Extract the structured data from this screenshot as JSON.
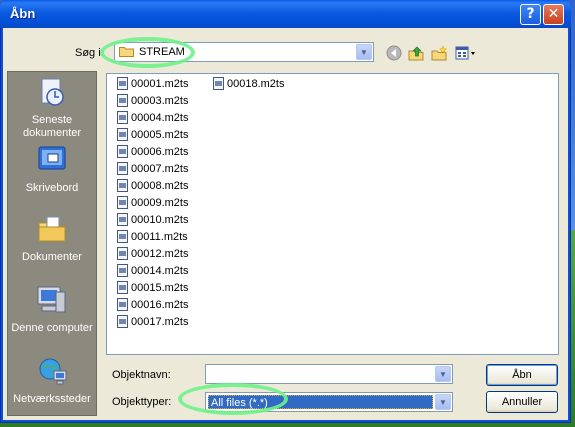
{
  "window": {
    "title": "Åbn",
    "help_label": "?",
    "close_label": "✕"
  },
  "lookin": {
    "label": "Søg i:",
    "value": "STREAM",
    "icons": [
      "folder-icon",
      "back-icon",
      "up-folder-icon",
      "new-folder-icon",
      "view-menu-icon"
    ]
  },
  "places": [
    {
      "label_line1": "Seneste",
      "label_line2": "dokumenter",
      "icon": "recent-documents-icon"
    },
    {
      "label_line1": "Skrivebord",
      "label_line2": "",
      "icon": "desktop-icon"
    },
    {
      "label_line1": "Dokumenter",
      "label_line2": "",
      "icon": "my-documents-icon"
    },
    {
      "label_line1": "Denne computer",
      "label_line2": "",
      "icon": "my-computer-icon"
    },
    {
      "label_line1": "Netværkssteder",
      "label_line2": "",
      "icon": "network-places-icon"
    }
  ],
  "files": [
    "00001.m2ts",
    "00003.m2ts",
    "00004.m2ts",
    "00005.m2ts",
    "00006.m2ts",
    "00007.m2ts",
    "00008.m2ts",
    "00009.m2ts",
    "00010.m2ts",
    "00011.m2ts",
    "00012.m2ts",
    "00014.m2ts",
    "00015.m2ts",
    "00016.m2ts",
    "00017.m2ts",
    "00018.m2ts"
  ],
  "filename": {
    "label": "Objektnavn:",
    "value": ""
  },
  "filetype": {
    "label": "Objekttyper:",
    "value": "All files (*.*)"
  },
  "buttons": {
    "open": "Åbn",
    "cancel": "Annuller"
  },
  "colors": {
    "title_bar": "#0a5ae0",
    "dialog_bg": "#ece9d8",
    "selection": "#316ac5",
    "highlight_ring": "#6ff28a"
  }
}
